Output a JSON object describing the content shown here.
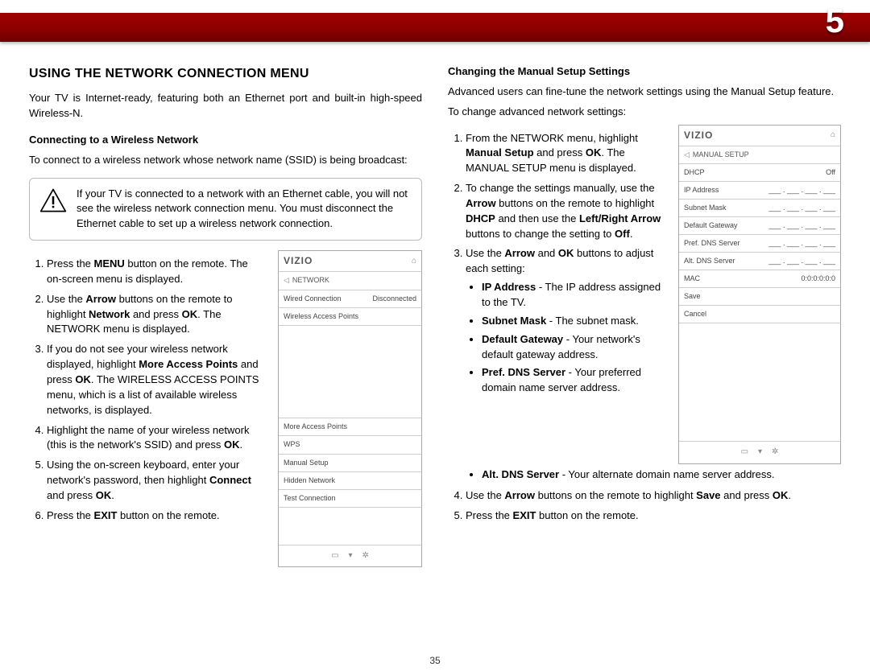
{
  "chapter": "5",
  "page_number": "35",
  "left": {
    "heading": "USING THE NETWORK CONNECTION MENU",
    "intro": "Your TV is Internet-ready, featuring both an Ethernet port and built-in high-speed Wireless-N.",
    "sub1": "Connecting to a Wireless Network",
    "sub1_intro": "To connect to a wireless network whose network name (SSID) is being broadcast:",
    "note": "If your TV is connected to a network with an Ethernet cable, you will not see the wireless network connection menu. You must disconnect the Ethernet cable to set up a wireless network connection.",
    "steps": {
      "s1a": "Press the ",
      "s1b": "MENU",
      "s1c": " button on the remote. The on-screen menu is displayed.",
      "s2a": "Use the ",
      "s2b": "Arrow",
      "s2c": " buttons on the remote to highlight ",
      "s2d": "Network",
      "s2e": " and press ",
      "s2f": "OK",
      "s2g": ". The NETWORK menu is displayed.",
      "s3a": "If you do not see your wireless network displayed, highlight ",
      "s3b": "More Access Points",
      "s3c": " and press ",
      "s3d": "OK",
      "s3e": ". The WIRELESS ACCESS POINTS menu, which is a list of available wireless networks, is displayed.",
      "s4a": "Highlight the name of your wireless network (this is the network's SSID) and press ",
      "s4b": "OK",
      "s4c": ".",
      "s5a": "Using the on-screen keyboard, enter your network's password, then highlight ",
      "s5b": "Connect",
      "s5c": " and press ",
      "s5d": "OK",
      "s5e": ".",
      "s6a": "Press the ",
      "s6b": "EXIT",
      "s6c": " button on the remote."
    }
  },
  "right": {
    "sub2": "Changing the Manual Setup Settings",
    "sub2_intro1": "Advanced users can fine-tune the network settings using the Manual Setup feature.",
    "sub2_intro2": "To change advanced network settings:",
    "steps": {
      "s1a": "From the NETWORK menu, highlight ",
      "s1b": "Manual Setup",
      "s1c": " and press ",
      "s1d": "OK",
      "s1e": ". The MANUAL SETUP menu is displayed.",
      "s2a": "To change the settings manually, use the ",
      "s2b": "Arrow",
      "s2c": " buttons on the remote to highlight ",
      "s2d": "DHCP",
      "s2e": " and then use the ",
      "s2f": "Left/Right Arrow",
      "s2g": " buttons to change the setting to ",
      "s2h": "Off",
      "s2i": ".",
      "s3a": "Use the ",
      "s3b": "Arrow",
      "s3c": " and ",
      "s3d": "OK",
      "s3e": " buttons to adjust each setting:",
      "b1a": "IP Address",
      "b1b": " - The IP address assigned to the TV.",
      "b2a": "Subnet Mask",
      "b2b": " - The subnet mask.",
      "b3a": "Default Gateway",
      "b3b": " - Your network's default gateway address.",
      "b4a": "Pref. DNS Server",
      "b4b": " - Your preferred domain name server address.",
      "b5a": "Alt. DNS Server",
      "b5b": " - Your alternate domain name server address.",
      "s4a": "Use the ",
      "s4b": "Arrow",
      "s4c": " buttons on the remote to highlight ",
      "s4d": "Save",
      "s4e": " and press ",
      "s4f": "OK",
      "s4g": ".",
      "s5a": "Press the ",
      "s5b": "EXIT",
      "s5c": " button on the remote."
    }
  },
  "menu1": {
    "brand": "VIZIO",
    "crumb": "NETWORK",
    "r1a": "Wired Connection",
    "r1b": "Disconnected",
    "r2": "Wireless Access Points",
    "r3": "More Access Points",
    "r4": "WPS",
    "r5": "Manual Setup",
    "r6": "Hidden Network",
    "r7": "Test Connection"
  },
  "menu2": {
    "brand": "VIZIO",
    "crumb": "MANUAL SETUP",
    "r1a": "DHCP",
    "r1b": "Off",
    "blank": "___ . ___ . ___ . ___",
    "r2": "IP Address",
    "r3": "Subnet Mask",
    "r4": "Default Gateway",
    "r5": "Pref. DNS Server",
    "r6": "Alt. DNS Server",
    "r7a": "MAC",
    "r7b": "0:0:0:0:0:0",
    "r8": "Save",
    "r9": "Cancel"
  }
}
